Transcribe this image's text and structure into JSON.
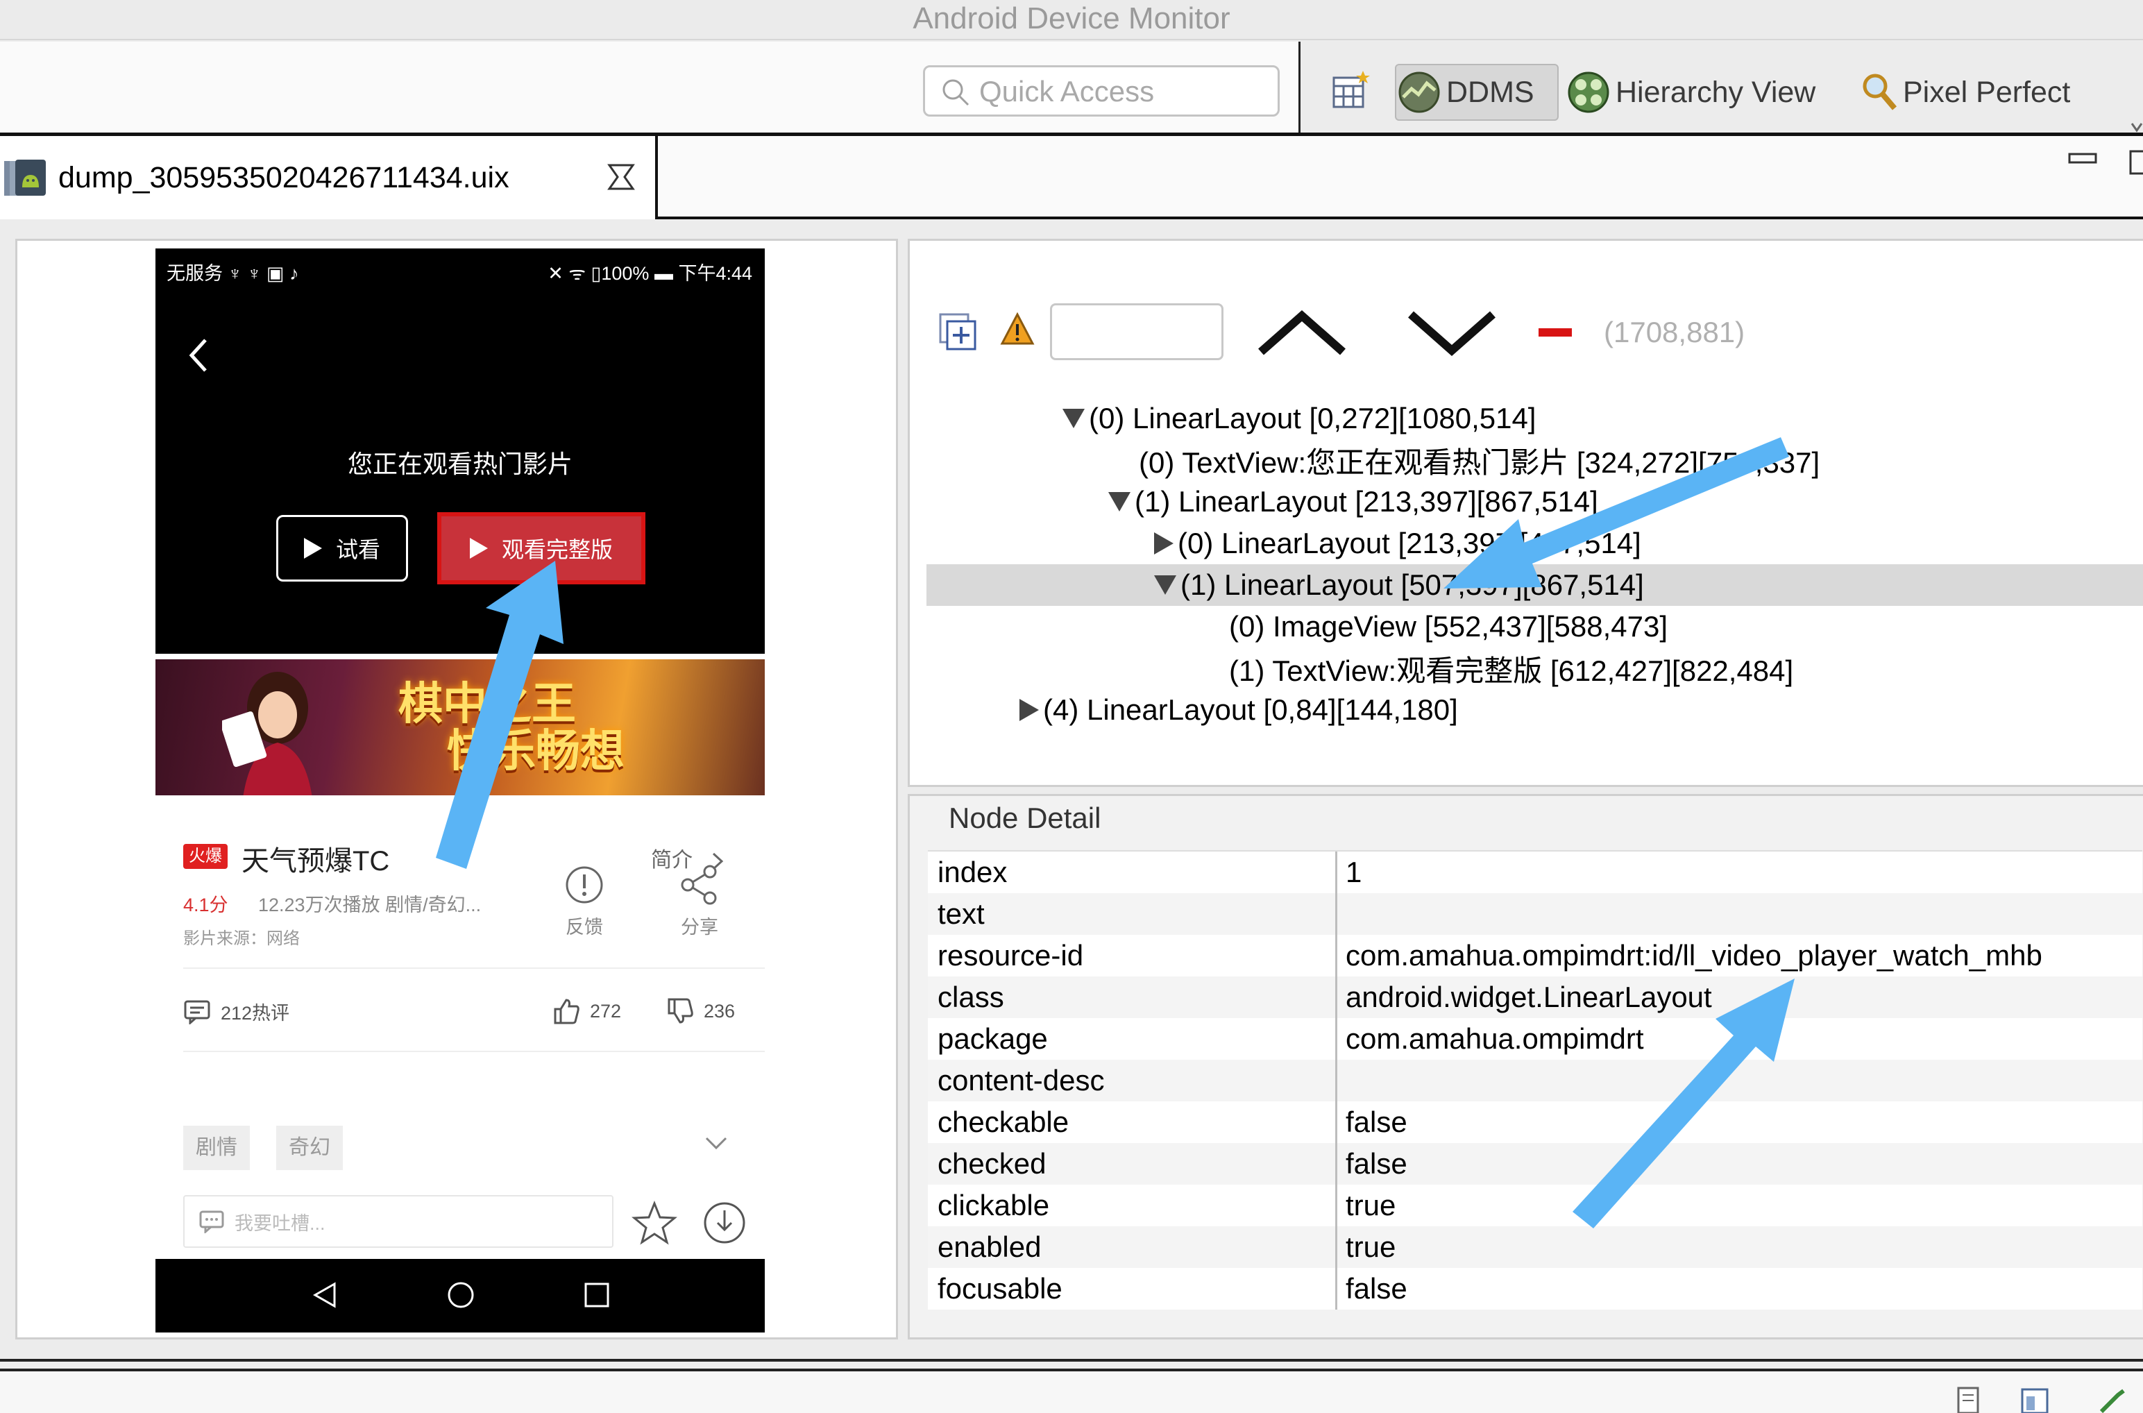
{
  "window": {
    "title": "Android Device Monitor"
  },
  "toolbar": {
    "quick_access_placeholder": "Quick Access",
    "perspectives": [
      {
        "label": "DDMS",
        "icon": "ddms-icon",
        "active": true
      },
      {
        "label": "Hierarchy View",
        "icon": "hierarchy-view-icon",
        "active": false
      },
      {
        "label": "Pixel Perfect",
        "icon": "magnifier-icon",
        "active": false
      }
    ]
  },
  "editor": {
    "tab_title": "dump_3059535020426711434.uix"
  },
  "phone": {
    "status_left": "无服务 ♆ ♆ ▣ ♪",
    "status_right": "✕ ᯤ ▯100% ▬ 下午4:44",
    "player_title": "您正在观看热门影片",
    "trial_label": "试看",
    "full_label": "观看完整版",
    "banner_line1": "棋中之王",
    "banner_line2": "快乐畅想",
    "hot_badge": "火爆",
    "movie_title": "天气预爆TC",
    "intro_label": "简介",
    "rating": "4.1分",
    "plays": "12.23万次播放 剧情/奇幻...",
    "source": "影片来源：网络",
    "feedback_label": "反馈",
    "share_label": "分享",
    "comment_count": "212热评",
    "likes": "272",
    "dislikes": "236",
    "tags": [
      "剧情",
      "奇幻"
    ],
    "comment_placeholder": "我要吐槽..."
  },
  "tree": {
    "coords": "(1708,881)",
    "rows": [
      {
        "text": "(0) LinearLayout [0,272][1080,514]",
        "toggle": "down"
      },
      {
        "text": "(0) TextView:您正在观看热门影片 [324,272][756,337]",
        "toggle": "none"
      },
      {
        "text": "(1) LinearLayout [213,397][867,514]",
        "toggle": "down"
      },
      {
        "text": "(0) LinearLayout [213,397][447,514]",
        "toggle": "right"
      },
      {
        "text": "(1) LinearLayout [507,397][867,514]",
        "toggle": "down",
        "selected": true
      },
      {
        "text": "(0) ImageView [552,437][588,473]",
        "toggle": "none"
      },
      {
        "text": "(1) TextView:观看完整版 [612,427][822,484]",
        "toggle": "none"
      },
      {
        "text": "(4) LinearLayout [0,84][144,180]",
        "toggle": "right"
      }
    ]
  },
  "detail": {
    "title": "Node Detail",
    "rows": [
      {
        "key": "index",
        "value": "1"
      },
      {
        "key": "text",
        "value": ""
      },
      {
        "key": "resource-id",
        "value": "com.amahua.ompimdrt:id/ll_video_player_watch_mhb"
      },
      {
        "key": "class",
        "value": "android.widget.LinearLayout"
      },
      {
        "key": "package",
        "value": "com.amahua.ompimdrt"
      },
      {
        "key": "content-desc",
        "value": ""
      },
      {
        "key": "checkable",
        "value": "false"
      },
      {
        "key": "checked",
        "value": "false"
      },
      {
        "key": "clickable",
        "value": "true"
      },
      {
        "key": "enabled",
        "value": "true"
      },
      {
        "key": "focusable",
        "value": "false"
      }
    ]
  },
  "colors": {
    "selected_node": "#d9d9d9",
    "highlight_box": "#d81414",
    "arrow": "#5ab4f5"
  }
}
